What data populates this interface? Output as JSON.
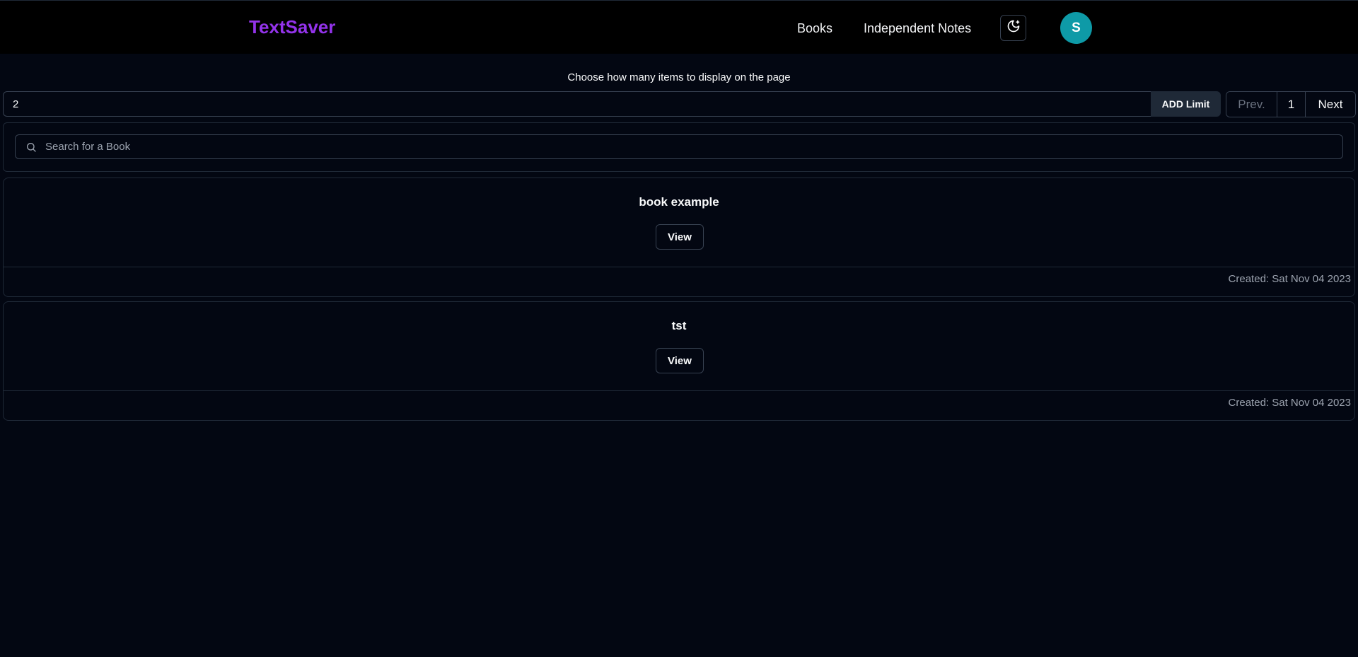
{
  "nav": {
    "brand": "TextSaver",
    "links": [
      "Books",
      "Independent Notes"
    ],
    "theme_icon": "moon-icon",
    "avatar_initial": "S"
  },
  "limit": {
    "label": "Choose how many items to display on the page",
    "value": "2",
    "button_label": "ADD Limit"
  },
  "pagination": {
    "prev": "Prev.",
    "current": "1",
    "next": "Next"
  },
  "search": {
    "placeholder": "Search for a Book",
    "icon": "search-icon"
  },
  "books": [
    {
      "title": "book example",
      "view_label": "View",
      "created": "Created: Sat Nov 04 2023"
    },
    {
      "title": "tst",
      "view_label": "View",
      "created": "Created: Sat Nov 04 2023"
    }
  ],
  "colors": {
    "background": "#030712",
    "navbar": "#000000",
    "brand": "#9333ea",
    "avatar": "#0e9aa7"
  }
}
